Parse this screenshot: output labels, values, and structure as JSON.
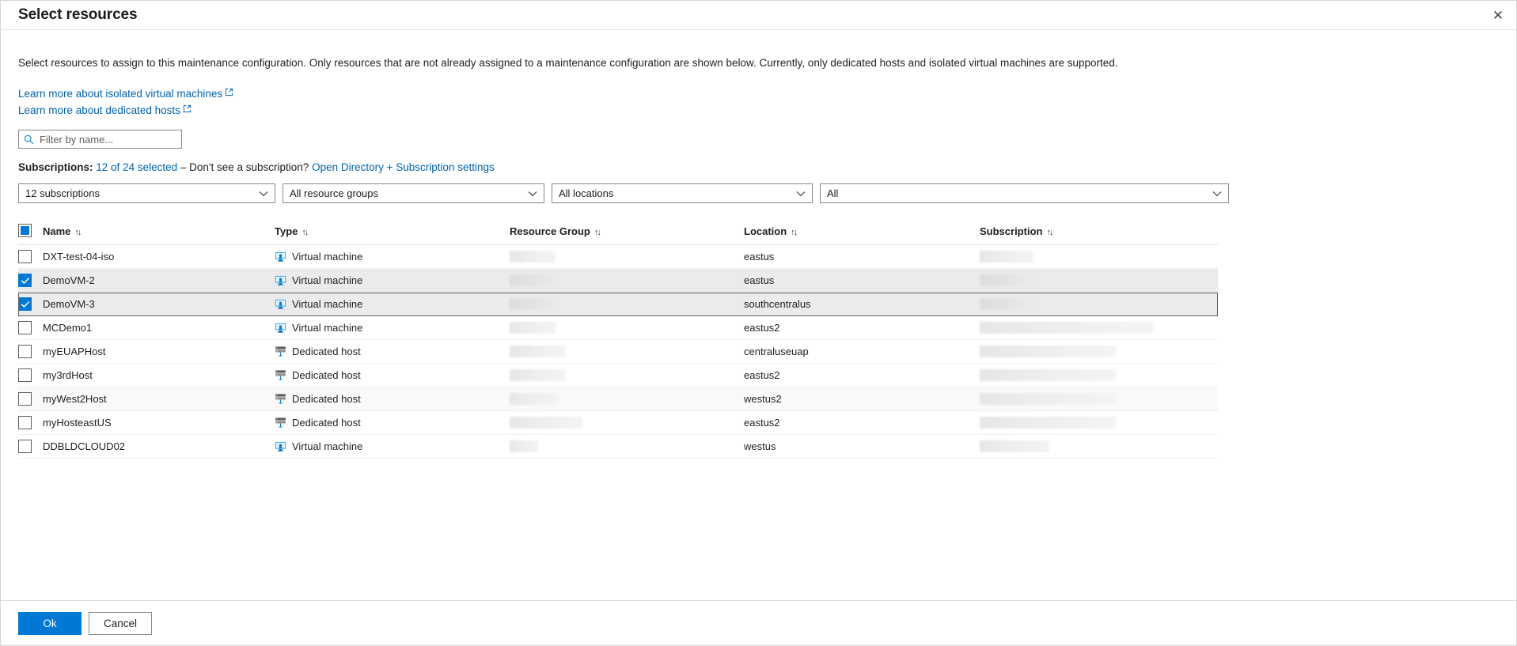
{
  "dialog": {
    "title": "Select resources",
    "close_label": "✕",
    "description": "Select resources to assign to this maintenance configuration. Only resources that are not already assigned to a maintenance configuration are shown below. Currently, only dedicated hosts and isolated virtual machines are supported."
  },
  "links": [
    {
      "label": "Learn more about isolated virtual machines",
      "icon": "external-link-icon"
    },
    {
      "label": "Learn more about dedicated hosts",
      "icon": "external-link-icon"
    }
  ],
  "filter": {
    "placeholder": "Filter by name...",
    "value": "",
    "icon": "search-icon"
  },
  "subscriptions_line": {
    "label": "Subscriptions:",
    "selected_link": "12 of 24 selected",
    "middle_text": "– Don't see a subscription?",
    "settings_link": "Open Directory + Subscription settings"
  },
  "dropdowns": [
    {
      "name": "subscription-filter",
      "value": "12 subscriptions"
    },
    {
      "name": "resource-group-filter",
      "value": "All resource groups"
    },
    {
      "name": "location-filter",
      "value": "All locations"
    },
    {
      "name": "type-filter",
      "value": "All"
    }
  ],
  "table": {
    "header_checkbox_state": "partial",
    "columns": [
      {
        "label": "Name",
        "sort": "↑↓"
      },
      {
        "label": "Type",
        "sort": "↑↓"
      },
      {
        "label": "Resource Group",
        "sort": "↑↓"
      },
      {
        "label": "Location",
        "sort": "↑↓"
      },
      {
        "label": "Subscription",
        "sort": "↑↓"
      }
    ],
    "rows": [
      {
        "name": "DXT-test-04-iso",
        "type": "Virtual machine",
        "type_icon": "virtual-machine-icon",
        "resource_group": "",
        "rg_redacted_width": 58,
        "location": "eastus",
        "subscription": "",
        "sub_redacted_width": 68,
        "selected": false,
        "focused": false,
        "alt": false
      },
      {
        "name": "DemoVM-2",
        "type": "Virtual machine",
        "type_icon": "virtual-machine-icon",
        "resource_group": "",
        "rg_redacted_width": 58,
        "location": "eastus",
        "subscription": "",
        "sub_redacted_width": 68,
        "selected": true,
        "focused": false,
        "alt": false
      },
      {
        "name": "DemoVM-3",
        "type": "Virtual machine",
        "type_icon": "virtual-machine-icon",
        "resource_group": "",
        "rg_redacted_width": 58,
        "location": "southcentralus",
        "subscription": "",
        "sub_redacted_width": 68,
        "selected": true,
        "focused": true,
        "alt": false
      },
      {
        "name": "MCDemo1",
        "type": "Virtual machine",
        "type_icon": "virtual-machine-icon",
        "resource_group": "",
        "rg_redacted_width": 58,
        "location": "eastus2",
        "subscription": "",
        "sub_redacted_width": 220,
        "selected": false,
        "focused": false,
        "alt": false
      },
      {
        "name": "myEUAPHost",
        "type": "Dedicated host",
        "type_icon": "dedicated-host-icon",
        "resource_group": "",
        "rg_redacted_width": 70,
        "location": "centraluseuap",
        "subscription": "",
        "sub_redacted_width": 172,
        "selected": false,
        "focused": false,
        "alt": false
      },
      {
        "name": "my3rdHost",
        "type": "Dedicated host",
        "type_icon": "dedicated-host-icon",
        "resource_group": "",
        "rg_redacted_width": 70,
        "location": "eastus2",
        "subscription": "",
        "sub_redacted_width": 172,
        "selected": false,
        "focused": false,
        "alt": false
      },
      {
        "name": "myWest2Host",
        "type": "Dedicated host",
        "type_icon": "dedicated-host-icon",
        "resource_group": "",
        "rg_redacted_width": 62,
        "location": "westus2",
        "subscription": "",
        "sub_redacted_width": 172,
        "selected": false,
        "focused": false,
        "alt": true
      },
      {
        "name": "myHosteastUS",
        "type": "Dedicated host",
        "type_icon": "dedicated-host-icon",
        "resource_group": "",
        "rg_redacted_width": 92,
        "location": "eastus2",
        "subscription": "",
        "sub_redacted_width": 172,
        "selected": false,
        "focused": false,
        "alt": false
      },
      {
        "name": "DDBLDCLOUD02",
        "type": "Virtual machine",
        "type_icon": "virtual-machine-icon",
        "resource_group": "",
        "rg_redacted_width": 36,
        "location": "westus",
        "subscription": "",
        "sub_redacted_width": 88,
        "selected": false,
        "focused": false,
        "alt": false
      }
    ]
  },
  "footer": {
    "ok_label": "Ok",
    "cancel_label": "Cancel"
  },
  "colors": {
    "accent": "#0078d4",
    "link": "#0062ad",
    "selected_row": "#ebebeb",
    "text": "#201f1e"
  }
}
